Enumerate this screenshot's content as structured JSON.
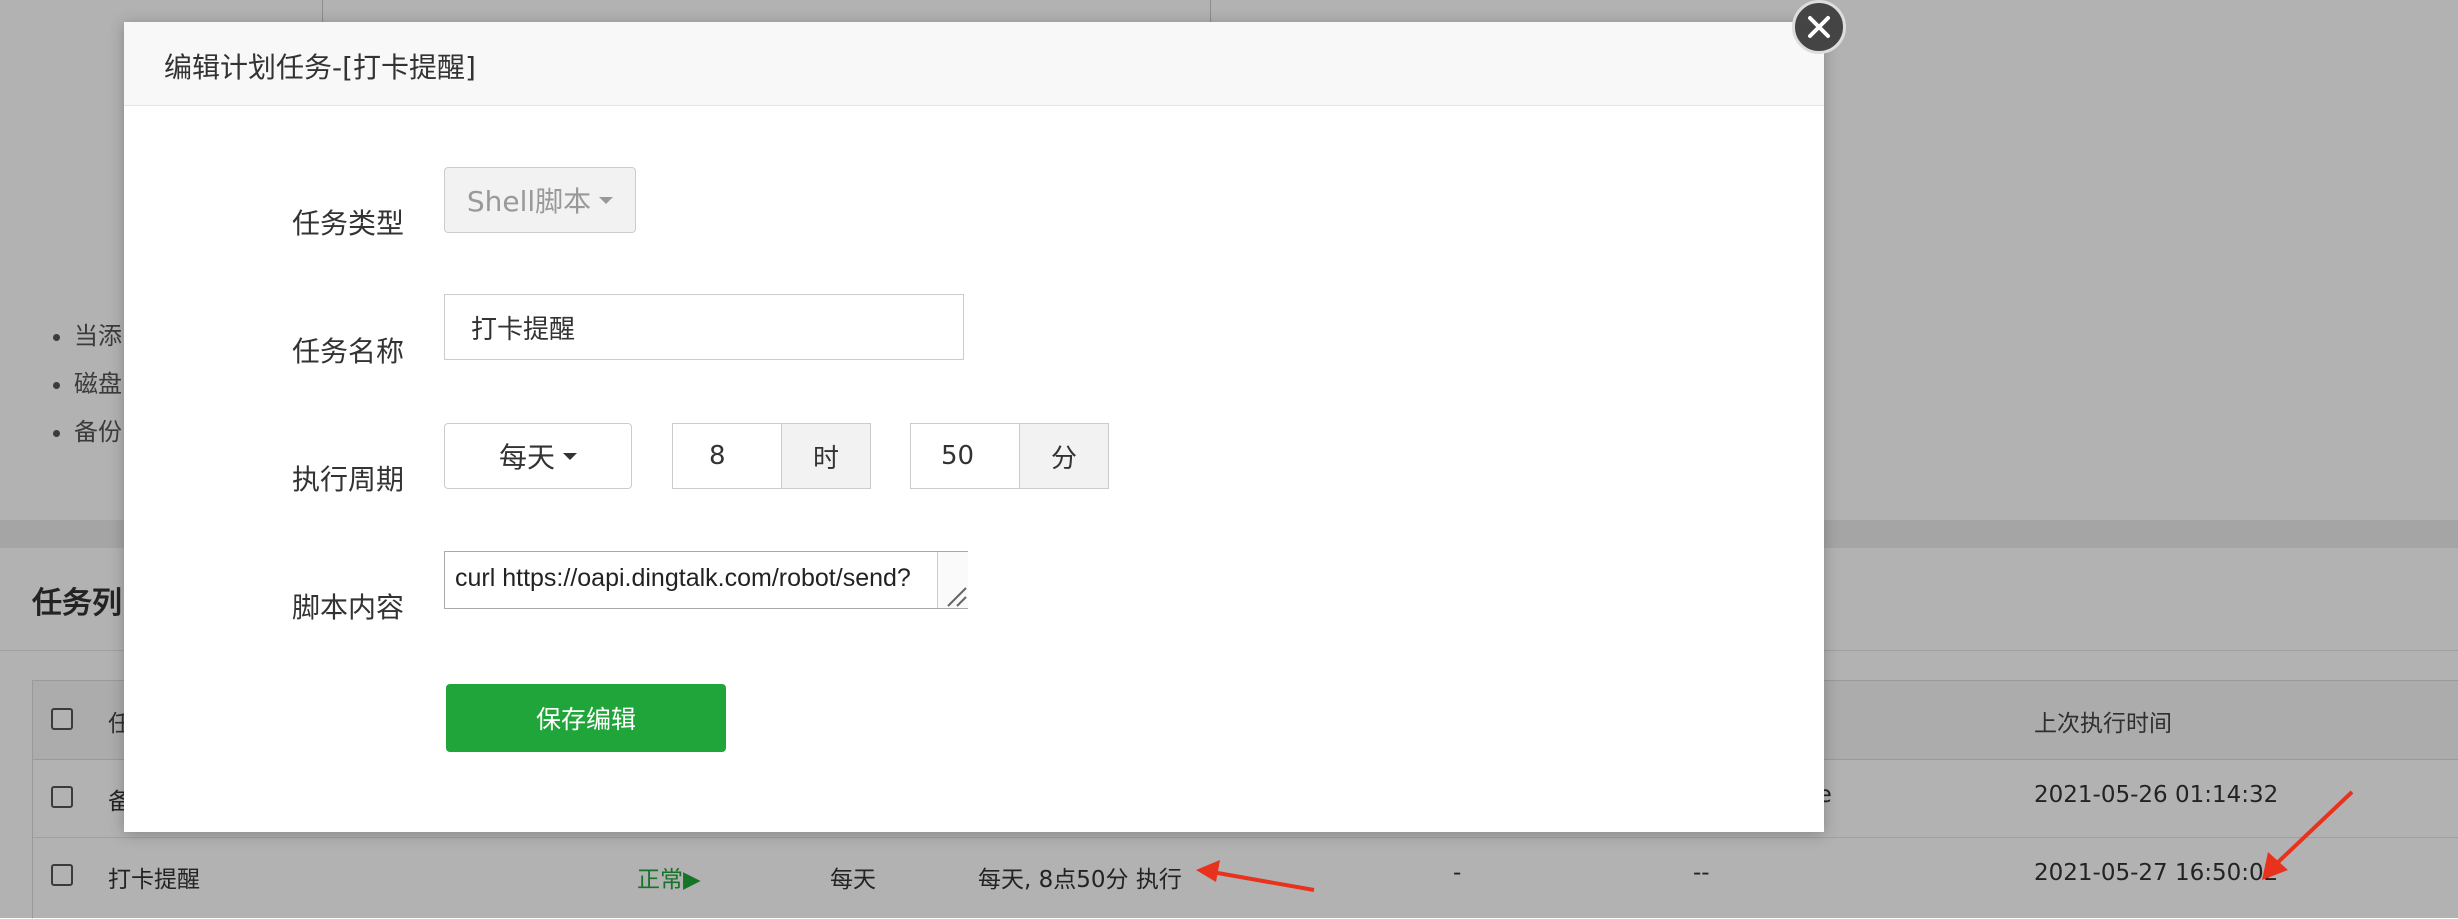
{
  "background": {
    "notes": [
      "当添",
      "磁盘",
      "备份"
    ],
    "panel_title": "任务列",
    "table": {
      "headers": {
        "name": "任",
        "last_run": "上次执行时间"
      },
      "rows": [
        {
          "name": "备",
          "status": "",
          "cycle": "",
          "cycle_desc": "",
          "col5": "",
          "col6": "ve",
          "last_run": "2021-05-26 01:14:32"
        },
        {
          "name": "打卡提醒",
          "status": "正常▶",
          "cycle": "每天",
          "cycle_desc": "每天, 8点50分 执行",
          "col5": "-",
          "col6": "--",
          "last_run": "2021-05-27 16:50:02"
        }
      ]
    },
    "arrow_color": "#e8321e"
  },
  "modal": {
    "title": "编辑计划任务-[打卡提醒]",
    "close_icon": "close-icon",
    "fields": {
      "task_type": {
        "label": "任务类型",
        "value": "Shell脚本"
      },
      "task_name": {
        "label": "任务名称",
        "value": "打卡提醒"
      },
      "period": {
        "label": "执行周期",
        "cycle_value": "每天",
        "hour_value": "8",
        "hour_unit": "时",
        "minute_value": "50",
        "minute_unit": "分"
      },
      "script": {
        "label": "脚本内容",
        "value": "curl https://oapi.dingtalk.com/robot/send?"
      }
    },
    "save_label": "保存编辑"
  },
  "colors": {
    "accent_green": "#20a53a",
    "overlay": "rgba(0,0,0,0.3)"
  }
}
